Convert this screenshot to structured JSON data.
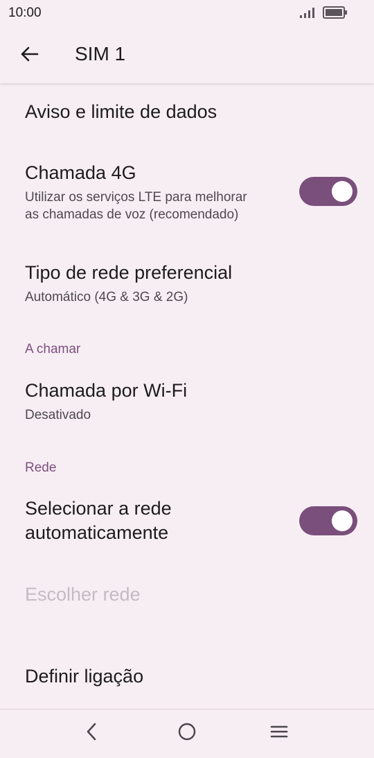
{
  "status_bar": {
    "time": "10:00",
    "icons": [
      "signal-icon",
      "battery-icon"
    ]
  },
  "app_bar": {
    "back_icon": "arrow-left-icon",
    "title": "SIM 1"
  },
  "items": {
    "data_warning": {
      "title": "Aviso e limite de dados"
    },
    "volte": {
      "title": "Chamada 4G",
      "summary_line1": "Utilizar os serviços LTE para melhorar",
      "summary_line2": "as chamadas de voz (recomendado)",
      "toggle_on": true
    },
    "network_type": {
      "title": "Tipo de rede preferencial",
      "summary": "Automático (4G & 3G & 2G)"
    },
    "calling_header": "A chamar",
    "wifi_calling": {
      "title": "Chamada por Wi-Fi",
      "summary": "Desativado"
    },
    "network_header": "Rede",
    "auto_select": {
      "title_line1": "Selecionar a rede",
      "title_line2": "automaticamente",
      "toggle_on": true
    },
    "choose_network": {
      "title": "Escolher rede",
      "disabled": true
    },
    "set_connection": {
      "title": "Definir ligação"
    }
  },
  "nav_bar": {
    "buttons": [
      "back-icon",
      "home-icon",
      "menu-icon"
    ]
  },
  "colors": {
    "background": "#f7eef3",
    "accent": "#7a4f7c",
    "section_header": "#7d4f7f",
    "disabled_text": "#c2bcc3"
  }
}
